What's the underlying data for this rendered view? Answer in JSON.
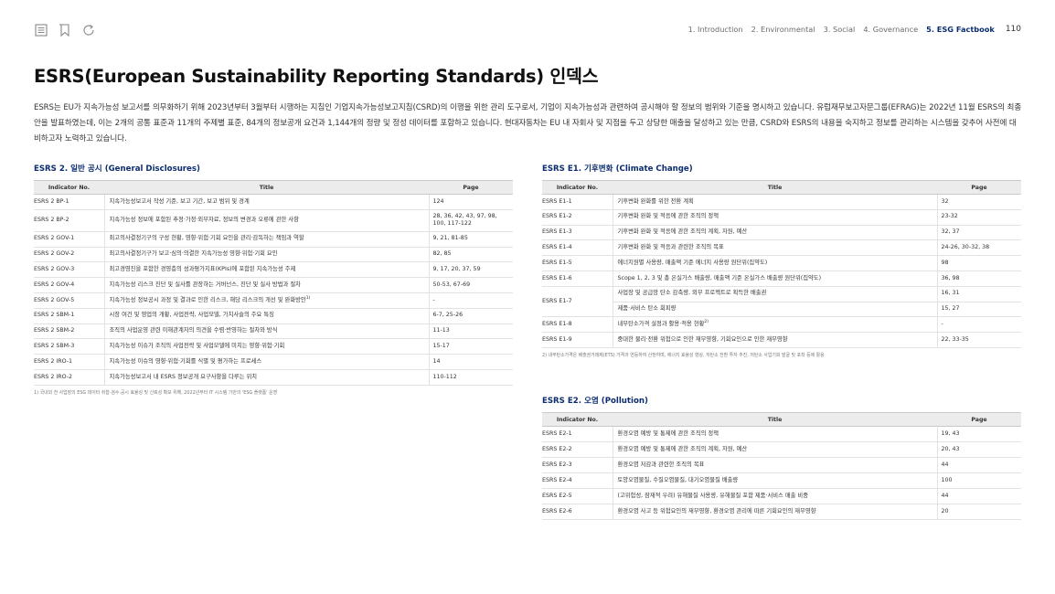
{
  "nav": {
    "items": [
      "1. Introduction",
      "2. Environmental",
      "3. Social",
      "4. Governance",
      "5. ESG Factbook"
    ],
    "active_index": 4,
    "page_number": "110"
  },
  "tools": [
    "list-icon",
    "bookmark-icon",
    "refresh-icon"
  ],
  "title": "ESRS(European Sustainability Reporting Standards) 인덱스",
  "intro": "ESRS는 EU가 지속가능성 보고서를 의무화하기 위해 2023년부터 3월부터 시행하는 지침인 기업지속가능성보고지침(CSRD)의 이행을 위한 관리 도구로서, 기업이 지속가능성과 관련하여 공시해야 할 정보의 범위와 기준을 명시하고 있습니다. 유럽재무보고자문그룹(EFRAG)는 2022년 11월 ESRS의 최종안을 발표하였는데, 이는 2개의 공통 표준과 11개의 주제별 표준, 84개의 정보공개 요건과 1,144개의 정량 및 정성 데이터를 포함하고 있습니다. 현대자동차는 EU 내 자회사 및 지점을 두고 상당한 매출을 달성하고 있는 만큼, CSRD와 ESRS의 내용을 숙지하고 정보를 관리하는 시스템을 갖추어 사전에 대비하고자 노력하고 있습니다.",
  "headers": {
    "indicator": "Indicator No.",
    "title": "Title",
    "page": "Page"
  },
  "esrs2": {
    "heading": "ESRS 2. 일반 공시 (General Disclosures)",
    "rows": [
      {
        "ind": "ESRS 2 BP-1",
        "title": "지속가능성보고서 작성 기준, 보고 기간, 보고 범위 및 경계",
        "page": "124"
      },
      {
        "ind": "ESRS 2 BP-2",
        "title": "지속가능성 정보에 포함된 추정·가정·외부자료, 정보의 변경과 오류에 관한 사항",
        "page": "28, 36, 42, 43, 97, 98, 100, 117-122"
      },
      {
        "ind": "ESRS 2 GOV-1",
        "title": "최고의사결정기구의 구성 현황, 영향·위험·기회 요인을 관리·감독하는 책임과 역할",
        "page": "9, 21, 81-85"
      },
      {
        "ind": "ESRS 2 GOV-2",
        "title": "최고의사결정기구가 보고·심의·의결한 지속가능성 영향·위험·기회 요인",
        "page": "82, 85"
      },
      {
        "ind": "ESRS 2 GOV-3",
        "title": "최고경영진을 포함한 경영층의 성과평가지표(KPIs)에 포함된 지속가능성 주제",
        "page": "9, 17, 20, 37, 59"
      },
      {
        "ind": "ESRS 2 GOV-4",
        "title": "지속가능성 리스크 진단 및 실사를 관장하는 거버넌스, 진단 및 실사 방법과 절차",
        "page": "50-53, 67-69"
      },
      {
        "ind": "ESRS 2 GOV-5",
        "title": "지속가능성 정보공시 과정 및 결과로 인한 리스크, 해당 리스크의 개선 및 완화방안",
        "sup": "1)",
        "page": "-"
      },
      {
        "ind": "ESRS 2 SBM-1",
        "title": "시장 여건 및 영업의 개황, 사업전략, 사업모델, 가치사슬의 주요 특징",
        "page": "6-7, 25-26"
      },
      {
        "ind": "ESRS 2 SBM-2",
        "title": "조직의 사업운영 관련 이해관계자의 의견을 수렴·반영하는 절차와 방식",
        "page": "11-13"
      },
      {
        "ind": "ESRS 2 SBM-3",
        "title": "지속가능성 이슈가 조직의 사업전략 및 사업모델에 미치는 영향·위험·기회",
        "page": "15-17"
      },
      {
        "ind": "ESRS 2 IRO-1",
        "title": "지속가능성 이슈의 영향·위험·기회를 식별 및 평가하는 프로세스",
        "page": "14"
      },
      {
        "ind": "ESRS 2 IRO-2",
        "title": "지속가능성보고서 내 ESRS 정보공개 요구사항을 다루는 위치",
        "page": "110-112"
      }
    ],
    "footnote": "1) 국내외 전 사업장의 ESG 데이터 취합·검수·공시 효율성 및 신뢰성 확보 위해, 2022년부터 IT 시스템 기반의 'ESG 플랫폼' 운영"
  },
  "e1": {
    "heading": "ESRS E1. 기후변화 (Climate Change)",
    "rows": [
      {
        "ind": "ESRS E1-1",
        "title": "기후변화 완화를 위한 전환 계획",
        "page": "32"
      },
      {
        "ind": "ESRS E1-2",
        "title": "기후변화 완화 및 적응에 관한 조직의 정책",
        "page": "23-32"
      },
      {
        "ind": "ESRS E1-3",
        "title": "기후변화 완화 및 적응에 관한 조직의 계획, 자원, 예산",
        "page": "32, 37"
      },
      {
        "ind": "ESRS E1-4",
        "title": "기후변화 완화 및 적응과 관련한 조직의 목표",
        "page": "24-26, 30-32, 38"
      },
      {
        "ind": "ESRS E1-5",
        "title": "에너지원별 사용량, 매출액 기준 에너지 사용량 원단위(집약도)",
        "page": "98"
      },
      {
        "ind": "ESRS E1-6",
        "title": "Scope 1, 2, 3 및 총 온실가스 배출량, 매출액 기준 온실가스 배출량 원단위(집약도)",
        "page": "36, 98"
      },
      {
        "ind": "ESRS E1-7",
        "subrows": [
          {
            "title": "사업장 및 공급망 탄소 감축량, 외부 프로젝트로 획득한 배출권",
            "page": "16, 31"
          },
          {
            "title": "제품·서비스 탄소 회피량",
            "page": "15, 27"
          }
        ]
      },
      {
        "ind": "ESRS E1-8",
        "title": "내부탄소가격 설정과 활용·적용 현황",
        "sup": "2)",
        "page": "-"
      },
      {
        "ind": "ESRS E1-9",
        "title": "중대한 물리·전환 위험으로 인한 재무영향, 기회요인으로 인한 재무영향",
        "page": "22, 33-35"
      }
    ],
    "footnote": "2) 내부탄소가격은 배출권거래제(ETS) 가격과 연동하여 산정하며, 에너지 효율성 향상, 저탄소 전환 투자 추진, 저탄소 사업기회 발굴 및 포착 등에 활용"
  },
  "e2": {
    "heading": "ESRS E2. 오염 (Pollution)",
    "rows": [
      {
        "ind": "ESRS E2-1",
        "title": "환경오염 예방 및 통제에 관한 조직의 정책",
        "page": "19, 43"
      },
      {
        "ind": "ESRS E2-2",
        "title": "환경오염 예방 및 통제에 관한 조직의 계획, 자원, 예산",
        "page": "20, 43"
      },
      {
        "ind": "ESRS E2-3",
        "title": "환경오염 저감과 관련한 조직의 목표",
        "page": "44"
      },
      {
        "ind": "ESRS E2-4",
        "title": "토양오염물질, 수질오염물질, 대기오염물질 배출량",
        "page": "100"
      },
      {
        "ind": "ESRS E2-5",
        "title": "(고위험성, 잠재적 우려) 유해물질 사용량, 유해물질 포함 제품·서비스 매출 비중",
        "page": "44"
      },
      {
        "ind": "ESRS E2-6",
        "title": "환경오염 사고 등 위험요인의 재무영향, 환경오염 관리에 따른 기회요인의 재무영향",
        "page": "20"
      }
    ]
  }
}
